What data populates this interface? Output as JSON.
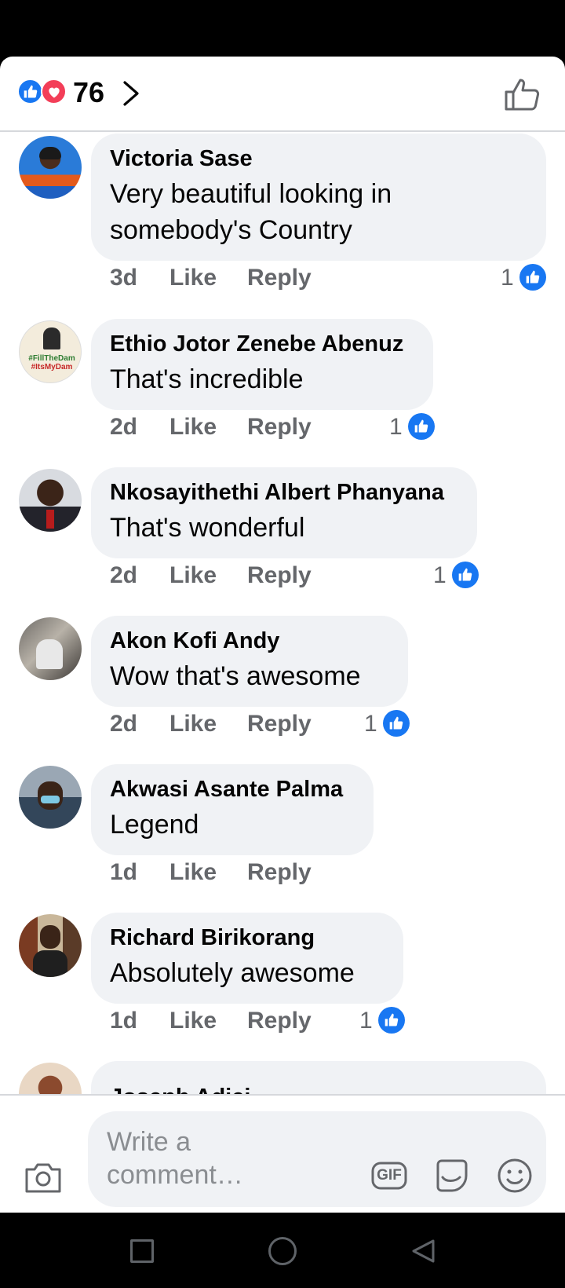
{
  "reactions": {
    "count": "76",
    "types": [
      "like",
      "love"
    ]
  },
  "comments": [
    {
      "author": "Victoria Sase",
      "text": "Very  beautiful looking in somebody's Country",
      "time": "3d",
      "like_label": "Like",
      "reply_label": "Reply",
      "reaction_count": "1"
    },
    {
      "author": "Ethio Jotor Zenebe Abenuz",
      "text": "That's incredible",
      "time": "2d",
      "like_label": "Like",
      "reply_label": "Reply",
      "reaction_count": "1",
      "avatar_text": [
        "#FillTheDam",
        "#ItsMyDam"
      ]
    },
    {
      "author": "Nkosayithethi Albert Phanyana",
      "text": "That's wonderful",
      "time": "2d",
      "like_label": "Like",
      "reply_label": "Reply",
      "reaction_count": "1"
    },
    {
      "author": "Akon Kofi Andy",
      "text": "Wow that's awesome",
      "time": "2d",
      "like_label": "Like",
      "reply_label": "Reply",
      "reaction_count": "1"
    },
    {
      "author": "Akwasi Asante Palma",
      "text": "Legend",
      "time": "1d",
      "like_label": "Like",
      "reply_label": "Reply"
    },
    {
      "author": "Richard Birikorang",
      "text": "Absolutely awesome",
      "time": "1d",
      "like_label": "Like",
      "reply_label": "Reply",
      "reaction_count": "1"
    },
    {
      "author": "Joseph Adjei"
    }
  ],
  "composer": {
    "placeholder": "Write a comment…",
    "gif_label": "GIF"
  },
  "colors": {
    "accent": "#1877f2",
    "love": "#f33e58",
    "bubble": "#f0f2f5",
    "secondary_text": "#65676b"
  }
}
